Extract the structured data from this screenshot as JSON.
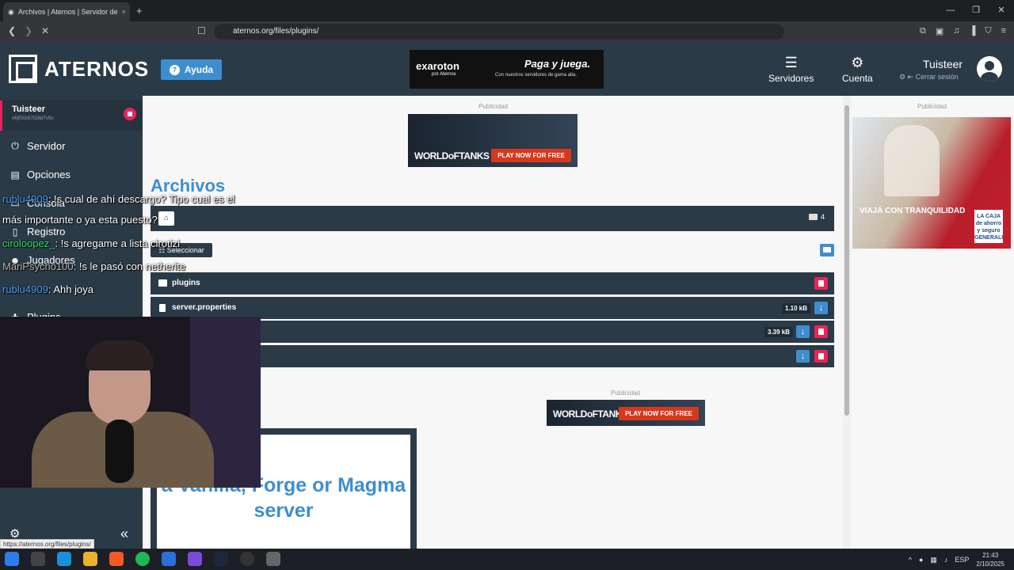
{
  "browser": {
    "tab_title": "Archivos | Aternos | Servidor de",
    "tab_close": "×",
    "new_tab": "+",
    "url": "aternos.org/files/plugins/",
    "status_url": "https://aternos.org/files/plugins/"
  },
  "header": {
    "logo": "ATERNOS",
    "help_label": "Ayuda",
    "ad": {
      "brand": "exaroton",
      "brand_sub": "por Aternos",
      "headline": "Paga y juega.",
      "sub": "Con nuestros servidores de gama alta."
    },
    "servers_label": "Servidores",
    "account_label": "Cuenta",
    "username": "Tuisteer",
    "logout_label": "Cerrar sesión"
  },
  "sidebar": {
    "server_name": "Tuisteer",
    "server_id": "#6jf0Xb57iD8dTv5n",
    "items": [
      {
        "label": "Servidor",
        "icon": "power-icon"
      },
      {
        "label": "Opciones",
        "icon": "options-icon"
      },
      {
        "label": "Consola",
        "icon": "console-icon"
      },
      {
        "label": "Registro",
        "icon": "log-icon"
      },
      {
        "label": "Jugadores",
        "icon": "players-icon"
      },
      {
        "label": "Plugins",
        "icon": "puzzle-icon"
      }
    ]
  },
  "main": {
    "ad_label": "Publicidad",
    "wot_logo": "WORLDoFTANKS",
    "wot_cta": "PLAY NOW FOR FREE",
    "title": "Archivos",
    "folder_count": "4",
    "select_label": "Seleccionar",
    "files": [
      {
        "name": "plugins",
        "type": "folder",
        "size": ""
      },
      {
        "name": "server.properties",
        "type": "file",
        "size": "1.10 kB"
      },
      {
        "name": "",
        "type": "file",
        "size": "3.39 kB"
      },
      {
        "name": "",
        "type": "file",
        "size": ""
      }
    ],
    "promo_text": "a Vanilla, Forge or Magma server"
  },
  "right_ad": {
    "label": "Publicidad",
    "text": "VIAJÁ CON TRANQUILIDAD",
    "brand": "LA CAJA de ahorro y seguro GENERALI"
  },
  "chat": [
    {
      "user": "rublu4909",
      "msg": ": !s cual de ahí descargo? Tipo cual es el"
    },
    {
      "user": "",
      "msg": "más importante o ya esta puesto?"
    },
    {
      "user": "ciroloopez_",
      "msg": ": !s agregame a lista cirotizi"
    },
    {
      "user": "MariPsycho100",
      "msg": ": !s le pasó con netherite"
    },
    {
      "user": "rublu4909",
      "msg": ": Ahh joya"
    }
  ],
  "taskbar": {
    "lang": "ESP",
    "time": "21:43",
    "date": "2/10/2025"
  },
  "colors": {
    "accent": "#3e8ecf",
    "danger": "#e8245b",
    "dark": "#2b3a47"
  }
}
